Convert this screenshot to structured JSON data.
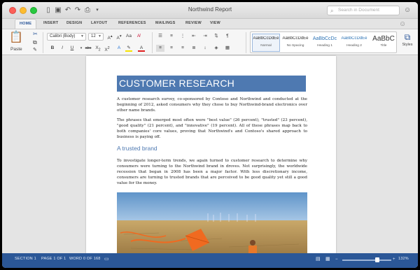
{
  "window": {
    "title": "Northwind Report"
  },
  "quick_access": {
    "icons": [
      "sidebar-icon",
      "save-icon",
      "undo-icon",
      "redo-icon",
      "print-icon",
      "more-icon"
    ]
  },
  "search": {
    "placeholder": "Search in Document"
  },
  "tabs": [
    "HOME",
    "INSERT",
    "DESIGN",
    "LAYOUT",
    "REFERENCES",
    "MAILINGS",
    "REVIEW",
    "VIEW"
  ],
  "ribbon": {
    "paste_label": "Paste",
    "font_name": "Calibri (Body)",
    "font_size": "12",
    "styles": [
      {
        "preview": "AaBbCcDdEe",
        "name": "Normal"
      },
      {
        "preview": "AaBbCcDdEe",
        "name": "No Spacing"
      },
      {
        "preview": "AaBbCcDc",
        "name": "Heading 1"
      },
      {
        "preview": "AaBbCcDdEe",
        "name": "Heading 2"
      },
      {
        "preview": "AaBbC",
        "name": "Title"
      }
    ],
    "styles_button": "Styles",
    "colors": {
      "highlight": "#f7e300",
      "font_color": "#e02020",
      "accent": "#2b579a"
    }
  },
  "document": {
    "title": "CUSTOMER RESEARCH",
    "para1": "A customer research survey, co-sponsored by Contoso and Northwind and conducted at the beginning of 2012, asked consumers why they chose to buy Northwind-brand electronics over other name brands.",
    "para2": "The phrases that emerged most often were \"best value\" (26 percent), \"trusted\" (23 percent), \"good quality\" (21 percent), and \"innovative\" (19 percent). All of these phrases map back to both companies' core values, proving that Northwind's and Contoso's shared approach to business is paying off.",
    "heading2": "A trusted brand",
    "para3": "To investigate longer-term trends, we again turned to customer research to determine why consumers were turning to the Northwind brand in droves. Not surprisingly, the worldwide recession that began in 2008 has been a major factor. With less discretionary income, consumers are turning to trusted brands that are perceived to be good quality yet still a good value for the money."
  },
  "status": {
    "section": "SECTION 1",
    "page": "PAGE 1 OF 1",
    "words": "WORD 0 OF 168",
    "zoom": "132%"
  }
}
